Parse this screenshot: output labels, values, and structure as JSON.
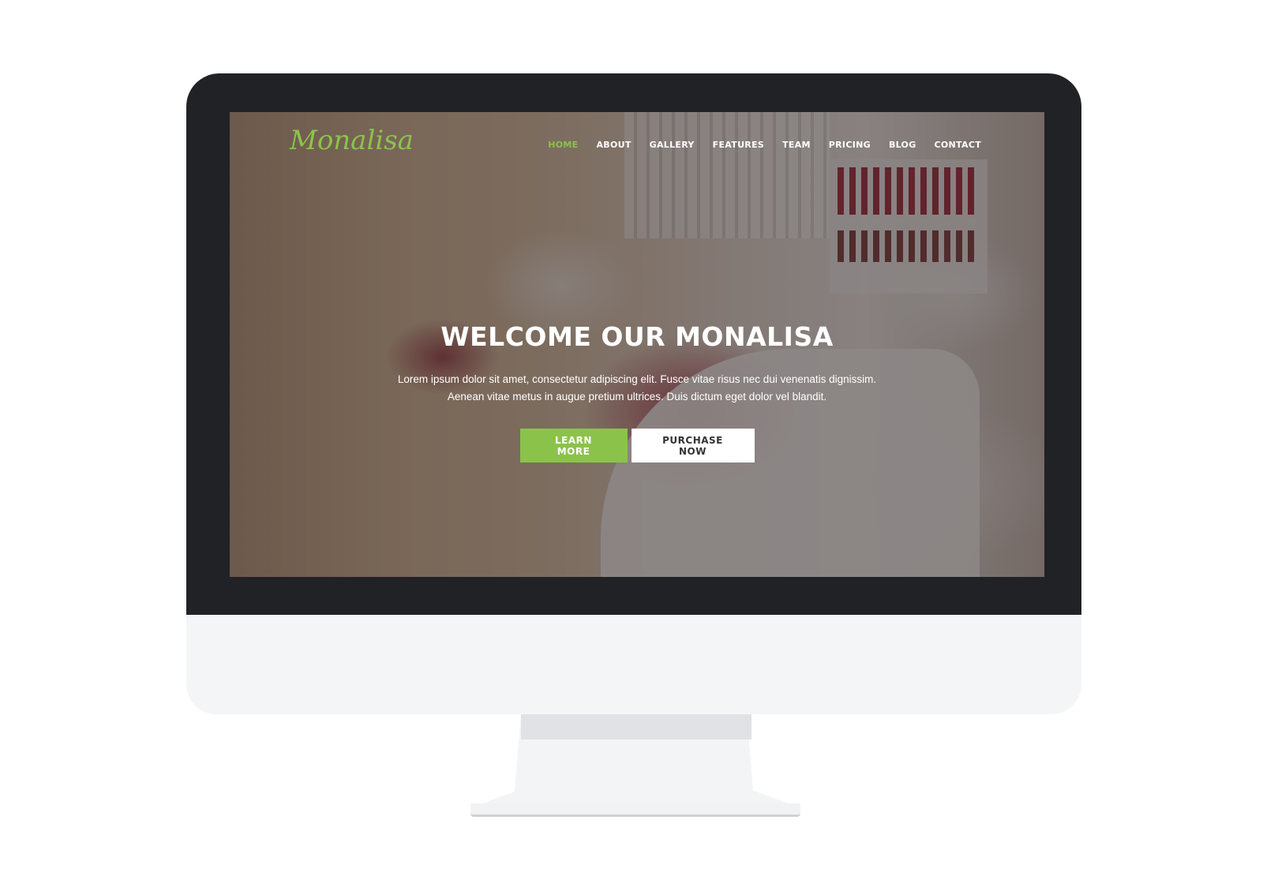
{
  "site": {
    "logo_text": "Monalisa",
    "brand_color": "#8bc34a"
  },
  "nav": {
    "items": [
      "HOME",
      "ABOUT",
      "GALLERY",
      "FEATURES",
      "TEAM",
      "PRICING",
      "BLOG",
      "CONTACT"
    ],
    "active": "HOME"
  },
  "hero": {
    "title": "WELCOME OUR MONALISA",
    "text_line1": "Lorem ipsum dolor sit amet, consectetur adipiscing elit. Fusce vitae risus nec dui venenatis dignissim.",
    "text_line2": "Aenean vitae metus in augue pretium ultrices. Duis dictum eget dolor vel blandit.",
    "learn_more_label": "LEARN MORE",
    "purchase_label": "PURCHASE NOW"
  },
  "colors": {
    "monitor_bezel": "#212226",
    "monitor_chin": "#f4f5f7",
    "primary_button": "#8bc34a",
    "secondary_button": "#ffffff"
  }
}
